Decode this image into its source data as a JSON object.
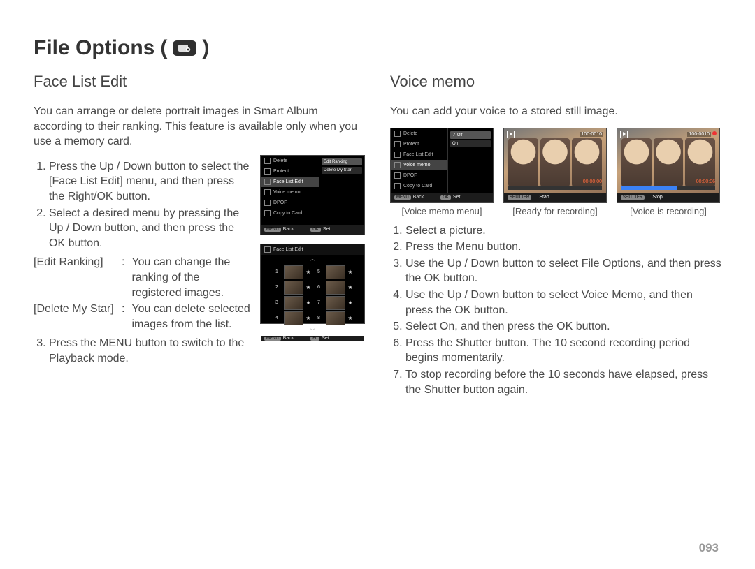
{
  "page_title": "File Options",
  "page_icon_name": "file-options-icon",
  "page_number": "093",
  "left": {
    "heading": "Face List Edit",
    "intro": "You can arrange or delete portrait images in Smart Album according to their ranking. This feature is available only when you use a memory card.",
    "steps": [
      "Press the Up / Down button to select the [Face List Edit] menu, and then press the Right/OK button.",
      "Select a desired menu by pressing the Up / Down button, and then press the OK button.",
      "Press the MENU button to switch to the Playback mode."
    ],
    "defs": [
      {
        "term": "[Edit Ranking]",
        "desc": "You can change the ranking of the registered images."
      },
      {
        "term": "[Delete My Star]",
        "desc": "You can delete selected images from the list."
      }
    ],
    "menu": {
      "items": [
        "Delete",
        "Protect",
        "Face List Edit",
        "Voice memo",
        "DPOF",
        "Copy to Card"
      ],
      "selected_index": 2,
      "submenu": [
        "Edit Ranking",
        "Delete My Star"
      ],
      "footer": {
        "back": "Back",
        "set": "Set",
        "menu_key": "MENU",
        "ok_key": "OK"
      }
    },
    "grid": {
      "title": "Face List Edit",
      "rows": [
        [
          1,
          5
        ],
        [
          2,
          6
        ],
        [
          3,
          7
        ],
        [
          4,
          8
        ]
      ],
      "footer": {
        "back": "Back",
        "set": "Set",
        "menu_key": "MENU",
        "fn_key": "Fn"
      }
    }
  },
  "right": {
    "heading": "Voice memo",
    "intro": "You can add your voice to a stored still image.",
    "shots": [
      {
        "caption": "[Voice memo menu]",
        "menu": {
          "items": [
            "Delete",
            "Protect",
            "Face List Edit",
            "Voice memo",
            "DPOF",
            "Copy to Card"
          ],
          "selected_index": 3,
          "submenu": [
            "Off",
            "On"
          ],
          "submenu_selected": 0,
          "footer": {
            "back": "Back",
            "set": "Set",
            "menu_key": "MENU",
            "ok_key": "OK"
          }
        }
      },
      {
        "caption": "[Ready for recording]",
        "photo": {
          "file": "100-0010",
          "time": "00:00:00",
          "footer_action": "Start",
          "footer_key": "SHUTTER",
          "rec": false
        }
      },
      {
        "caption": "[Voice is recording]",
        "photo": {
          "file": "100-0010",
          "time": "00:00:06",
          "footer_action": "Stop",
          "footer_key": "SHUTTER",
          "rec": true
        }
      }
    ],
    "steps": [
      "Select a picture.",
      "Press the Menu button.",
      "Use the Up / Down button to select File Options, and then press the OK button.",
      "Use the Up / Down button to select Voice Memo, and then press the OK button.",
      "Select On, and then press the OK button.",
      "Press the Shutter button. The 10 second recording period begins momentarily.",
      "To stop recording before the 10 seconds have elapsed, press the Shutter button again."
    ]
  }
}
